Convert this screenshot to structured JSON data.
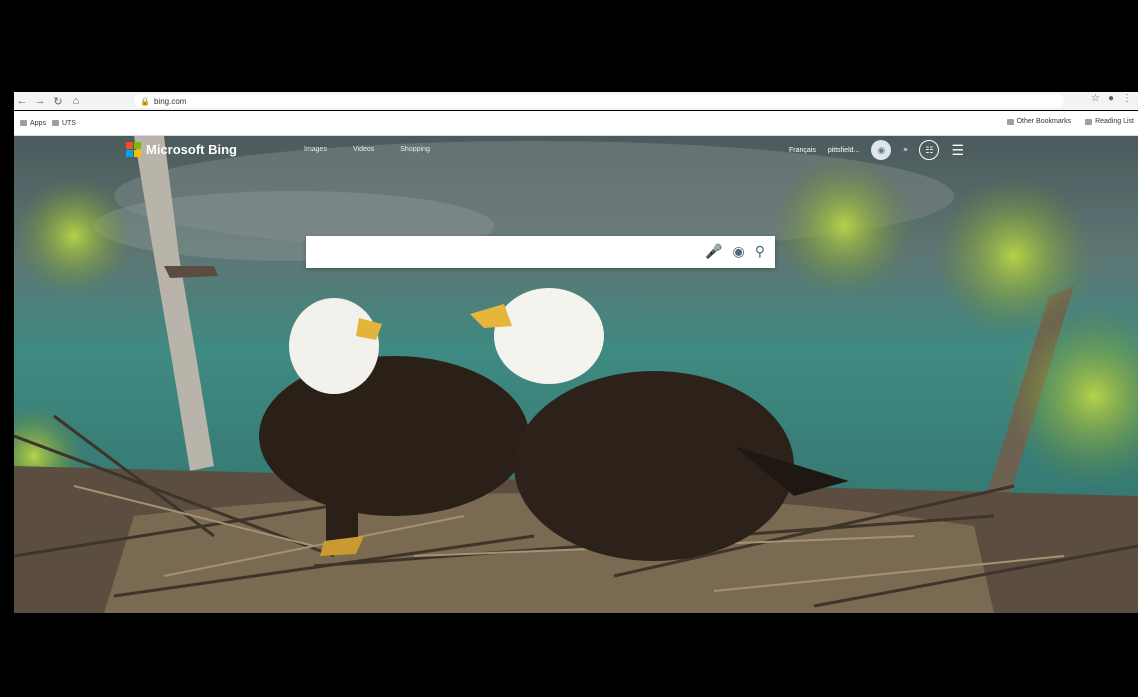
{
  "browser": {
    "url": "bing.com",
    "bookmarks": [
      {
        "label": "Apps"
      },
      {
        "label": "UTS"
      }
    ],
    "other_bookmarks": "Other Bookmarks",
    "reading_list": "Reading List"
  },
  "bing": {
    "brand": "Microsoft Bing",
    "nav": [
      "Images",
      "Videos",
      "Shopping"
    ],
    "language": "Français",
    "user": "pittsfield...",
    "search_placeholder": ""
  },
  "colors": {
    "ms_red": "#f25022",
    "ms_green": "#7fba00",
    "ms_blue": "#00a4ef",
    "ms_yellow": "#ffb900"
  }
}
